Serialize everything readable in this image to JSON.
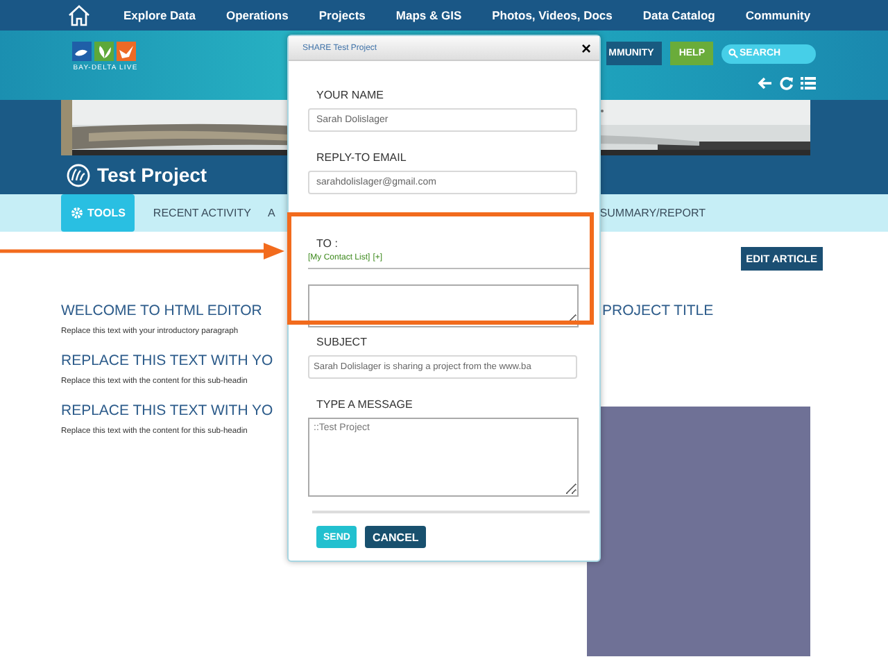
{
  "top_nav": {
    "items": [
      "Explore Data",
      "Operations",
      "Projects",
      "Maps & GIS",
      "Photos, Videos, Docs",
      "Data Catalog",
      "Community"
    ]
  },
  "header": {
    "logo_text": "BAY-DELTA LIVE",
    "buttons": [
      {
        "label": "MMUNITY",
        "kind": "community"
      },
      {
        "label": "HELP",
        "kind": "help"
      }
    ],
    "search": {
      "placeholder": "SEARCH"
    }
  },
  "project": {
    "title": "Test Project"
  },
  "tabs": [
    {
      "label": "TOOLS",
      "selected": true
    },
    {
      "label": "RECENT ACTIVITY",
      "selected": false
    },
    {
      "label": "A",
      "selected": false
    },
    {
      "label": "SUMMARY/REPORT",
      "selected": false
    }
  ],
  "edit_button": "EDIT ARTICLE",
  "content": [
    {
      "kind": "heading",
      "text": "WELCOME TO HTML EDITOR"
    },
    {
      "kind": "paragraph",
      "text": "Replace this text with your introductory paragraph"
    },
    {
      "kind": "heading",
      "text": "REPLACE THIS TEXT WITH YO"
    },
    {
      "kind": "paragraph",
      "text": "Replace this text with the content for this sub-headin"
    },
    {
      "kind": "heading",
      "text": "REPLACE THIS TEXT WITH YO"
    },
    {
      "kind": "paragraph",
      "text": "Replace this text with the content for this sub-headin"
    }
  ],
  "right_heading": "PROJECT TITLE",
  "dialog": {
    "title": "SHARE Test Project",
    "close": "×",
    "your_name": {
      "label": "YOUR NAME",
      "value": "Sarah Dolislager"
    },
    "reply_to": {
      "label": "REPLY-TO EMAIL",
      "value": "sarahdolislager@gmail.com"
    },
    "to": {
      "label": "TO :",
      "links": [
        "[My Contact List]",
        "[+]"
      ]
    },
    "subject": {
      "label": "SUBJECT",
      "value": "Sarah Dolislager is sharing a project from the www.ba"
    },
    "message": {
      "label": "TYPE A MESSAGE",
      "value": "::Test Project"
    },
    "buttons": [
      {
        "label": "SEND",
        "kind": "primary"
      },
      {
        "label": "CANCEL",
        "kind": "secondary"
      }
    ]
  }
}
